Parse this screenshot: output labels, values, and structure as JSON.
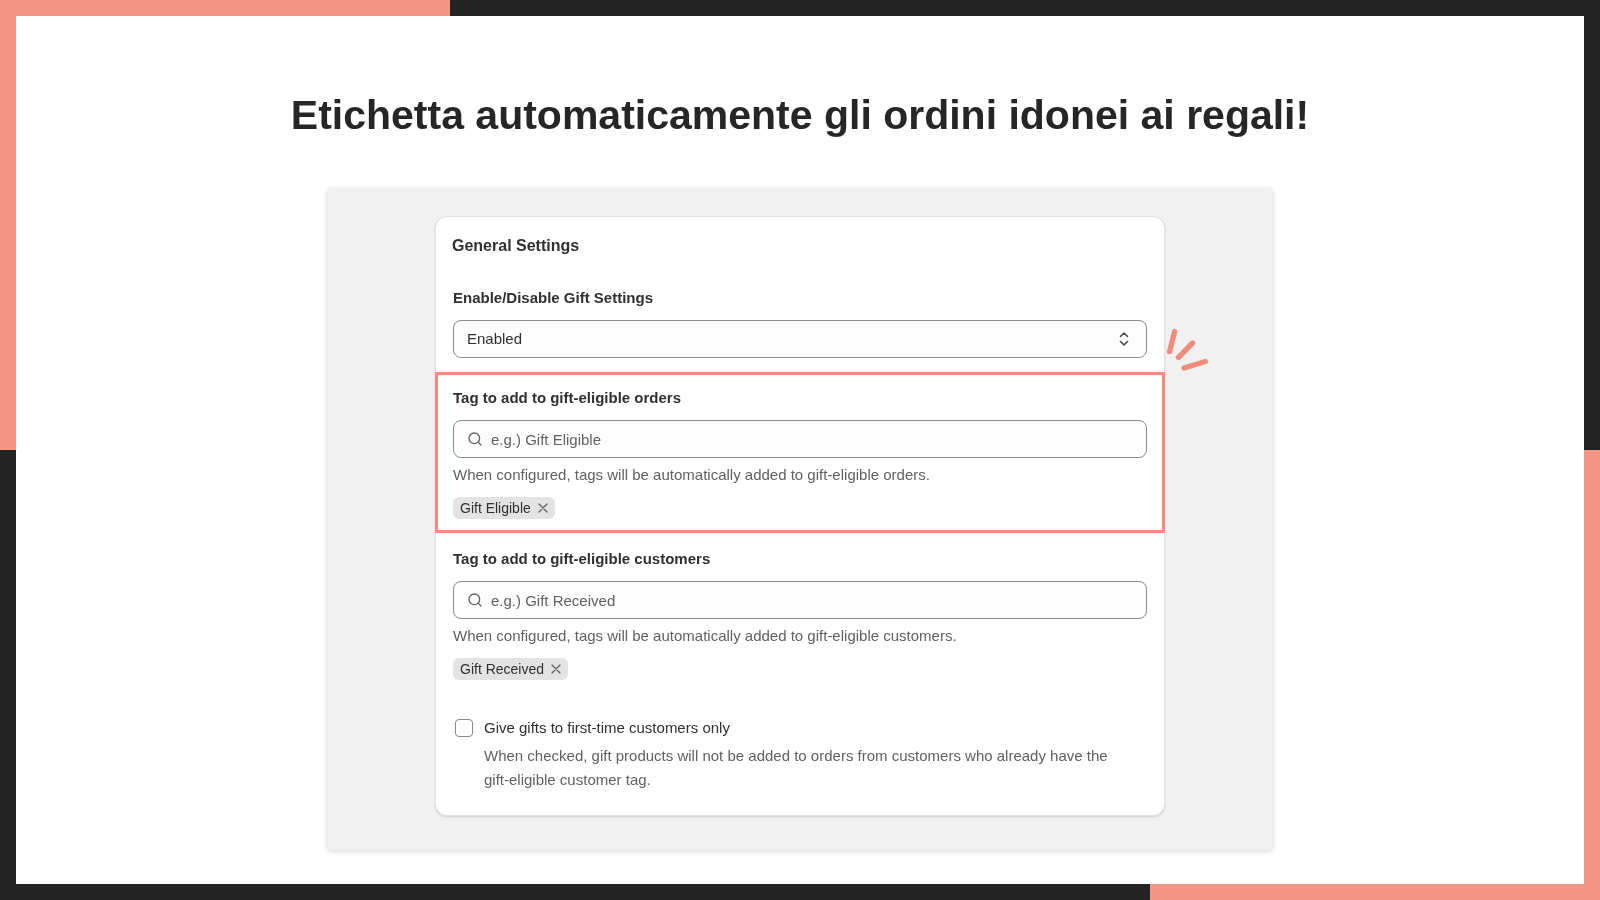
{
  "headline": "Etichetta automaticamente gli ordini idonei ai regali!",
  "settings_card": {
    "title": "General Settings",
    "sections": [
      {
        "kind": "select",
        "label": "Enable/Disable Gift Settings",
        "value": "Enabled",
        "highlighted": false
      },
      {
        "kind": "tag_input",
        "label": "Tag to add to gift-eligible orders",
        "placeholder": "e.g.) Gift Eligible",
        "help": "When configured, tags will be automatically added to gift-eligible orders.",
        "tags": [
          "Gift Eligible"
        ],
        "highlighted": true
      },
      {
        "kind": "tag_input",
        "label": "Tag to add to gift-eligible customers",
        "placeholder": "e.g.) Gift Received",
        "help": "When configured, tags will be automatically added to gift-eligible customers.",
        "tags": [
          "Gift Received"
        ],
        "highlighted": false
      },
      {
        "kind": "checkbox",
        "label": "Give gifts to first-time customers only",
        "checked": false,
        "help": "When checked, gift products will not be added to orders from customers who already have the gift-eligible customer tag.",
        "highlighted": false
      }
    ]
  }
}
